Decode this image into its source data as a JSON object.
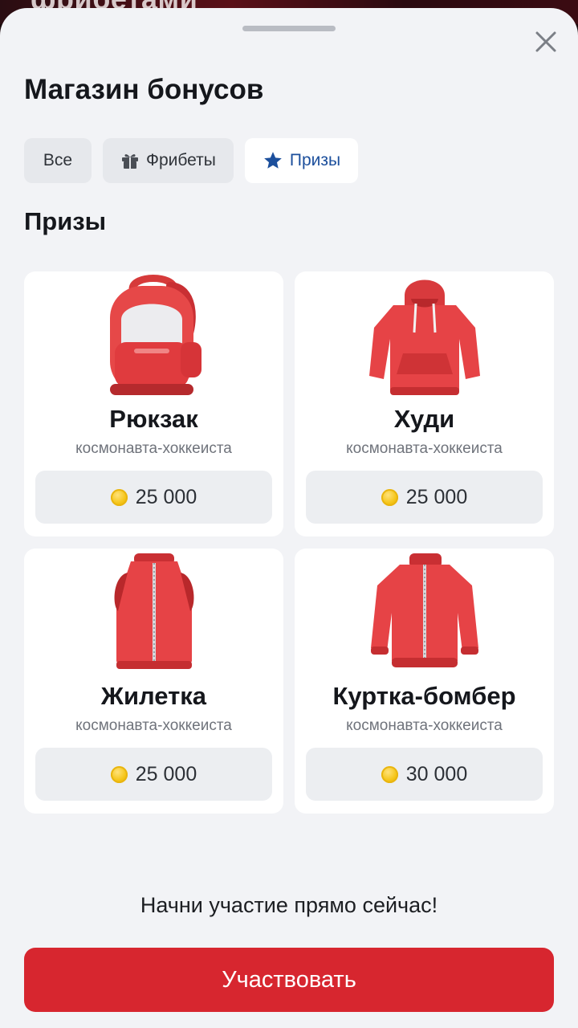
{
  "backdrop": {
    "text": "фрибетами"
  },
  "sheet": {
    "title": "Магазин бонусов",
    "tabs": [
      {
        "label": "Все",
        "icon": "",
        "active": false
      },
      {
        "label": "Фрибеты",
        "icon": "gift-icon",
        "active": false
      },
      {
        "label": "Призы",
        "icon": "star-icon",
        "active": true
      }
    ],
    "section_title": "Призы",
    "items": [
      {
        "name": "Рюкзак",
        "subtitle": "космонавта-хоккеиста",
        "price": "25 000",
        "icon": "backpack-image"
      },
      {
        "name": "Худи",
        "subtitle": "космонавта-хоккеиста",
        "price": "25 000",
        "icon": "hoodie-image"
      },
      {
        "name": "Жилетка",
        "subtitle": "космонавта-хоккеиста",
        "price": "25 000",
        "icon": "vest-image"
      },
      {
        "name": "Куртка-бомбер",
        "subtitle": "космонавта-хоккеиста",
        "price": "30 000",
        "icon": "bomber-jacket-image"
      }
    ],
    "cta_text": "Начни участие прямо сейчас!",
    "cta_button": "Участвовать"
  },
  "colors": {
    "accent_red": "#d7262f",
    "active_tab_text": "#1c4f9c",
    "sheet_bg": "#f2f3f6",
    "coin": "#f5c518"
  }
}
